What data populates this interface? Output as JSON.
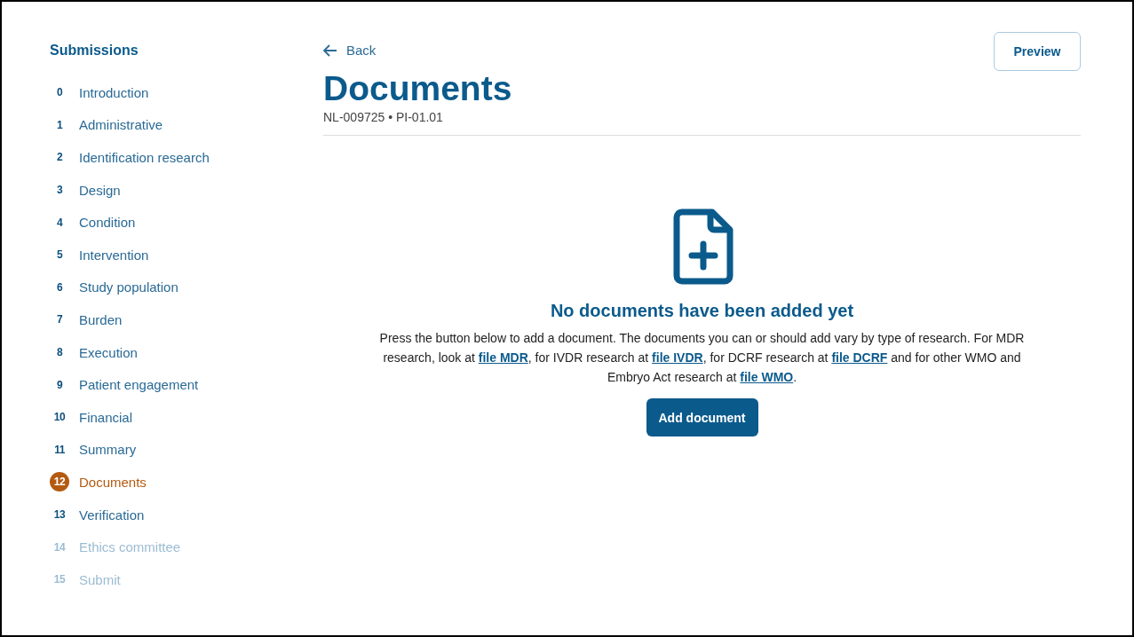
{
  "sidebar": {
    "title": "Submissions",
    "items": [
      {
        "number": "0",
        "label": "Introduction",
        "selected": false,
        "disabled": false
      },
      {
        "number": "1",
        "label": "Administrative",
        "selected": false,
        "disabled": false
      },
      {
        "number": "2",
        "label": "Identification research",
        "selected": false,
        "disabled": false
      },
      {
        "number": "3",
        "label": "Design",
        "selected": false,
        "disabled": false
      },
      {
        "number": "4",
        "label": "Condition",
        "selected": false,
        "disabled": false
      },
      {
        "number": "5",
        "label": "Intervention",
        "selected": false,
        "disabled": false
      },
      {
        "number": "6",
        "label": "Study population",
        "selected": false,
        "disabled": false
      },
      {
        "number": "7",
        "label": "Burden",
        "selected": false,
        "disabled": false
      },
      {
        "number": "8",
        "label": "Execution",
        "selected": false,
        "disabled": false
      },
      {
        "number": "9",
        "label": "Patient engagement",
        "selected": false,
        "disabled": false
      },
      {
        "number": "10",
        "label": "Financial",
        "selected": false,
        "disabled": false
      },
      {
        "number": "11",
        "label": "Summary",
        "selected": false,
        "disabled": false
      },
      {
        "number": "12",
        "label": "Documents",
        "selected": true,
        "disabled": false
      },
      {
        "number": "13",
        "label": "Verification",
        "selected": false,
        "disabled": false
      },
      {
        "number": "14",
        "label": "Ethics committee",
        "selected": false,
        "disabled": true
      },
      {
        "number": "15",
        "label": "Submit",
        "selected": false,
        "disabled": true
      }
    ]
  },
  "back": "Back",
  "preview_button": "Preview",
  "title": "Documents",
  "subtitle": "NL-009725 • PI-01.01",
  "empty_state": {
    "heading": "No documents have been added yet",
    "description": [
      {
        "kind": "text",
        "text": "Press the button below to add a document. The documents you can or should add vary by type of research. For MDR research, look at "
      },
      {
        "kind": "link",
        "text": "file MDR"
      },
      {
        "kind": "text",
        "text": ", for IVDR research at "
      },
      {
        "kind": "link",
        "text": "file IVDR"
      },
      {
        "kind": "text",
        "text": ", for DCRF research at "
      },
      {
        "kind": "link",
        "text": "file DCRF"
      },
      {
        "kind": "text",
        "text": " and for other WMO and Embryo Act research at "
      },
      {
        "kind": "link",
        "text": "file WMO"
      },
      {
        "kind": "text",
        "text": "."
      }
    ],
    "button": "Add document"
  }
}
